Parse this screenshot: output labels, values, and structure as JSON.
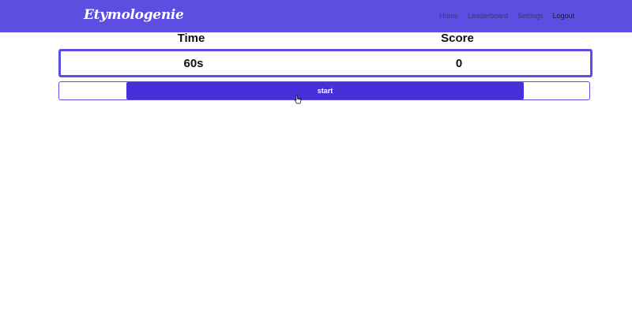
{
  "navbar": {
    "brand": "Etymologenie",
    "links": [
      "Home",
      "Leaderboard",
      "Settings"
    ],
    "logout_label": "Logout",
    "background_color": "#5b4ee0"
  },
  "game": {
    "time_label": "Time",
    "score_label": "Score",
    "time_value": "60s",
    "score_value": "0",
    "start_label": "start",
    "accent_color": "#4630d8"
  },
  "cursor": {
    "icon": "hand-pointer-icon"
  }
}
